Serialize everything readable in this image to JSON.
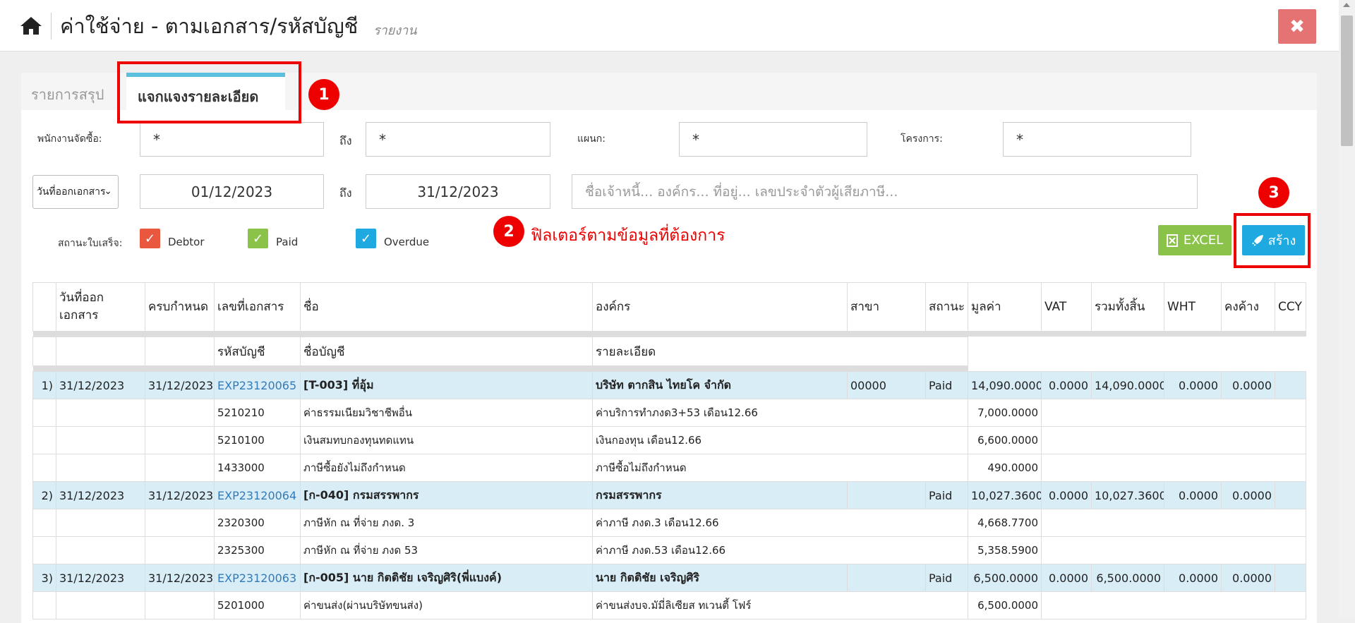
{
  "header": {
    "title": "ค่าใช้จ่าย - ตามเอกสาร/รหัสบัญชี",
    "subtitle": "รายงาน",
    "close_label": "✖"
  },
  "tabs": [
    {
      "label": "รายการสรุป",
      "active": false
    },
    {
      "label": "แจกแจงรายละเอียด",
      "active": true
    }
  ],
  "annotations": {
    "n1": "1",
    "n2": "2",
    "n3": "3",
    "note2": "ฟิลเตอร์ตามข้อมูลที่ต้องการ",
    "color": "#ee0000"
  },
  "filters": {
    "buyer_label": "พนักงานจัดซื้อ:",
    "buyer_from": "*",
    "to_label": "ถึง",
    "buyer_to": "*",
    "dept_label": "แผนก:",
    "dept_value": "*",
    "project_label": "โครงการ:",
    "project_value": "*",
    "date_type": "วันที่ออกเอกสาร",
    "date_from": "01/12/2023",
    "date_to": "31/12/2023",
    "search_placeholder": "ชื่อเจ้าหนี้... องค์กร... ที่อยู่... เลขประจำตัวผู้เสียภาษี...",
    "status_label": "สถานะใบเสร็จ:",
    "statuses": [
      {
        "label": "Debtor",
        "checked": true,
        "color": "#e9573f"
      },
      {
        "label": "Paid",
        "checked": true,
        "color": "#8bc34a"
      },
      {
        "label": "Overdue",
        "checked": true,
        "color": "#1fa9e1"
      }
    ]
  },
  "buttons": {
    "excel": "EXCEL",
    "create": "สร้าง"
  },
  "table": {
    "headers": [
      "",
      "วันที่ออก\nเอกสาร",
      "ครบกำหนด",
      "เลขที่เอกสาร",
      "ชื่อ",
      "องค์กร",
      "สาขา",
      "สถานะ",
      "มูลค่า",
      "VAT",
      "รวมทั้งสิ้น",
      "WHT",
      "คงค้าง",
      "CCY"
    ],
    "subheaders": [
      "รหัสบัญชี",
      "ชื่อบัญชี",
      "รายละเอียด"
    ],
    "rows": [
      {
        "no": "1)",
        "date": "31/12/2023",
        "due": "31/12/2023",
        "doc": "EXP23120065",
        "name": "[T-003] ที่อุ้ม",
        "org": "บริษัท ตากสิน ไทยโค จำกัด",
        "branch": "00000",
        "status": "Paid",
        "amount": "14,090.0000",
        "vat": "0.0000",
        "total": "14,090.0000",
        "wht": "0.0000",
        "balance": "0.0000",
        "ccy": "",
        "lines": [
          {
            "code": "5210210",
            "account": "ค่าธรรมเนียมวิชาชีพอื่น",
            "detail": "ค่าบริการทำภงด3+53 เดือน12.66",
            "amount": "7,000.0000"
          },
          {
            "code": "5210100",
            "account": "เงินสมทบกองทุนทดแทน",
            "detail": "เงินกองทุน เดือน12.66",
            "amount": "6,600.0000"
          },
          {
            "code": "1433000",
            "account": "ภาษีซื้อยังไม่ถึงกำหนด",
            "detail": "ภาษีซื้อไม่ถึงกำหนด",
            "amount": "490.0000"
          }
        ]
      },
      {
        "no": "2)",
        "date": "31/12/2023",
        "due": "31/12/2023",
        "doc": "EXP23120064",
        "name": "[ก-040] กรมสรรพากร",
        "org": "กรมสรรพากร",
        "branch": "",
        "status": "Paid",
        "amount": "10,027.3600",
        "vat": "0.0000",
        "total": "10,027.3600",
        "wht": "0.0000",
        "balance": "0.0000",
        "ccy": "",
        "lines": [
          {
            "code": "2320300",
            "account": "ภาษีหัก ณ ที่จ่าย ภงด. 3",
            "detail": "ค่าภาษี ภงด.3 เดือน12.66",
            "amount": "4,668.7700"
          },
          {
            "code": "2325300",
            "account": "ภาษีหัก ณ ที่จ่าย ภงด 53",
            "detail": "ค่าภาษี ภงด.53 เดือน12.66",
            "amount": "5,358.5900"
          }
        ]
      },
      {
        "no": "3)",
        "date": "31/12/2023",
        "due": "31/12/2023",
        "doc": "EXP23120063",
        "name": "[ก-005] นาย กิตติชัย เจริญศิริ(พี่แบงค์)",
        "org": "นาย กิตติชัย เจริญศิริ",
        "branch": "",
        "status": "Paid",
        "amount": "6,500.0000",
        "vat": "0.0000",
        "total": "6,500.0000",
        "wht": "0.0000",
        "balance": "0.0000",
        "ccy": "",
        "lines": [
          {
            "code": "5201000",
            "account": "ค่าขนส่ง(ผ่านบริษัทขนส่ง)",
            "detail": "ค่าขนส่งบจ.มัมี่ลิเซียส ทเวนตี้ โฟร์",
            "amount": "6,500.0000"
          }
        ]
      }
    ]
  }
}
